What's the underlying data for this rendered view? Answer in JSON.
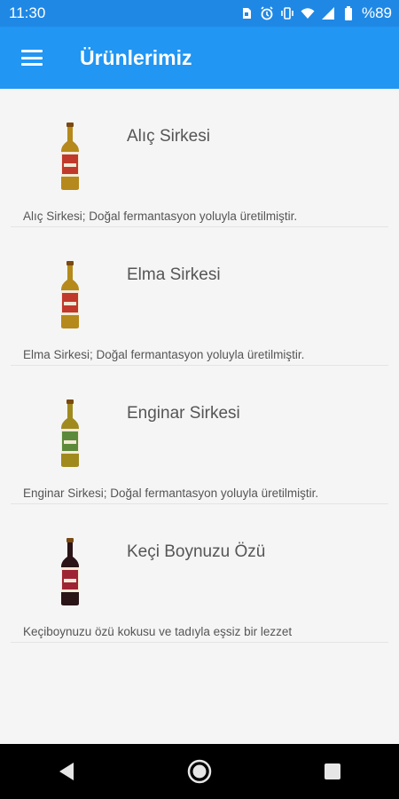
{
  "status_bar": {
    "time": "11:30",
    "battery": "%89",
    "icons": [
      "sim-icon",
      "alarm-icon",
      "vibrate-icon",
      "wifi-icon",
      "signal-icon",
      "battery-icon"
    ]
  },
  "app_bar": {
    "title": "Ürünlerimiz",
    "menu_icon": "menu-icon"
  },
  "products": [
    {
      "name": "Alıç Sirkesi",
      "description": "Alıç Sirkesi; Doğal fermantasyon yoluyla üretilmiştir.",
      "bottle_color": "#b5891b",
      "label_color": "#c0392b"
    },
    {
      "name": "Elma Sirkesi",
      "description": "Elma Sirkesi; Doğal fermantasyon yoluyla üretilmiştir.",
      "bottle_color": "#b5891b",
      "label_color": "#c0392b"
    },
    {
      "name": "Enginar Sirkesi",
      "description": "Enginar Sirkesi; Doğal fermantasyon yoluyla üretilmiştir.",
      "bottle_color": "#a08a1e",
      "label_color": "#5d8a3a"
    },
    {
      "name": "Keçi Boynuzu Özü",
      "description": "Keçiboynuzu özü kokusu ve tadıyla eşsiz bir lezzet",
      "bottle_color": "#2a1418",
      "label_color": "#9e2434"
    }
  ],
  "nav_bar": {
    "icons": [
      "back-icon",
      "home-icon",
      "recents-icon"
    ]
  },
  "colors": {
    "app_bar": "#2196f3",
    "status_bar": "#1f88e5",
    "background": "#f5f5f5",
    "text": "#555555"
  }
}
